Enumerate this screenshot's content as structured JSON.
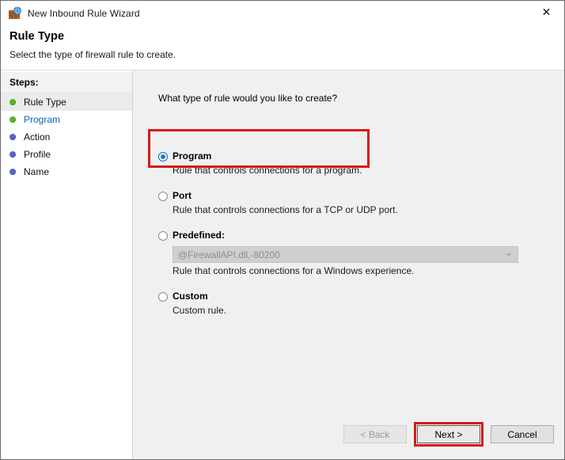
{
  "window": {
    "title": "New Inbound Rule Wizard",
    "icon": "firewall-globe-icon",
    "close_label": "✕"
  },
  "header": {
    "title": "Rule Type",
    "subtitle": "Select the type of firewall rule to create."
  },
  "sidebar": {
    "heading": "Steps:",
    "items": [
      {
        "label": "Rule Type",
        "state": "current",
        "bullet": "green"
      },
      {
        "label": "Program",
        "state": "link",
        "bullet": "green"
      },
      {
        "label": "Action",
        "state": "pending",
        "bullet": "blue"
      },
      {
        "label": "Profile",
        "state": "pending",
        "bullet": "blue"
      },
      {
        "label": "Name",
        "state": "pending",
        "bullet": "blue"
      }
    ]
  },
  "main": {
    "question": "What type of rule would you like to create?",
    "options": [
      {
        "label": "Program",
        "description": "Rule that controls connections for a program.",
        "selected": true,
        "highlighted": true
      },
      {
        "label": "Port",
        "description": "Rule that controls connections for a TCP or UDP port.",
        "selected": false,
        "highlighted": false
      },
      {
        "label": "Predefined:",
        "description": "Rule that controls connections for a Windows experience.",
        "selected": false,
        "highlighted": false,
        "combo_value": "@FirewallAPI.dll,-80200"
      },
      {
        "label": "Custom",
        "description": "Custom rule.",
        "selected": false,
        "highlighted": false
      }
    ]
  },
  "footer": {
    "back_label": "< Back",
    "next_label": "Next >",
    "cancel_label": "Cancel"
  },
  "colors": {
    "highlight_red": "#d61a1a",
    "accent_blue": "#1976c8",
    "link_blue": "#0a62bb",
    "step_done_green": "#5cb42c",
    "step_pending_blue": "#5b62c9",
    "panel_gray": "#f0f0f0"
  }
}
